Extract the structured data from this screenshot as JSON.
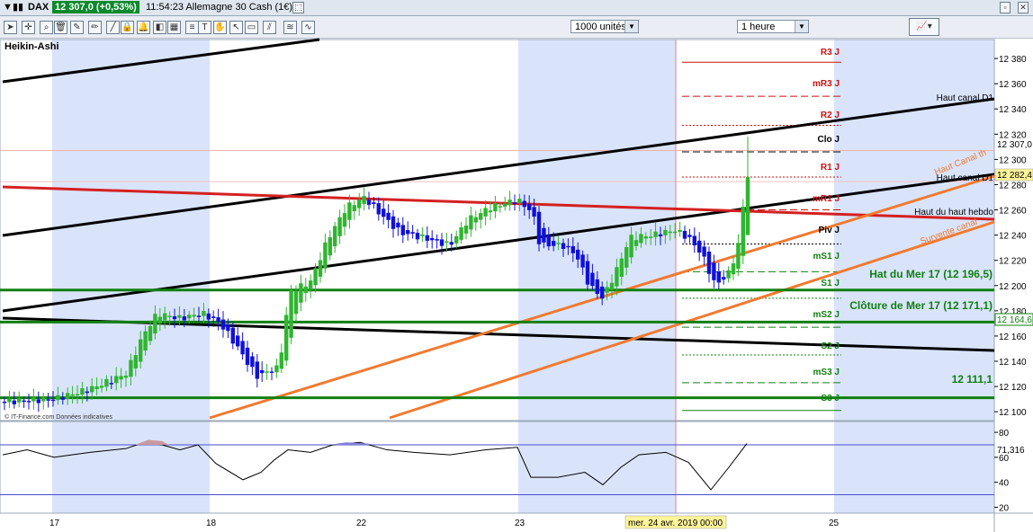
{
  "app": {
    "symbol": "DAX",
    "price": "12 307,0 (+0,53%)",
    "time_instrument": "11:54:23 Allemagne 30 Cash (1€)",
    "chart_type": "Heikin-Ashi",
    "units_select": "1000 unités",
    "timeframe_select": "1 heure",
    "watermark": "© IT-Finance.com Données indicatives"
  },
  "price_axis": {
    "ticks": [
      "12 380",
      "12 360",
      "12 340",
      "12 320",
      "12 300",
      "12 280",
      "12 260",
      "12 240",
      "12 220",
      "12 200",
      "12 180",
      "12 160",
      "12 140",
      "12 120",
      "12 100"
    ],
    "current_price_label": "12 307,0",
    "marker_282": "12 282,4",
    "marker_164": "12 164,6"
  },
  "pivot_labels": {
    "r3": "R3 J",
    "mr3": "mR3 J",
    "r2": "R2 J",
    "clo": "Clo J",
    "r1": "R1 J",
    "mr1": "mR1 J",
    "piv": "Piv J",
    "ms1": "mS1 J",
    "s1": "S1 J",
    "ms2": "mS2 J",
    "s2": "S2 J",
    "ms3": "mS3 J",
    "s3": "S3 J"
  },
  "annotations": {
    "haut_canal_d1_top": "Haut canal D1",
    "haut_canal_d1_mid": "Haut canal D1",
    "haut_canal_th": "Haut Canal th",
    "haut_du_haut_hebdo": "Haut du haut hebdo",
    "survente_canal": "Survente canal",
    "hat_mer": "Hat du Mer 17 (12 196,5)",
    "cloture_mer": "Clôture de Mer 17 (12 171,1)",
    "level_12111": "12 111,1"
  },
  "oscillator": {
    "ticks": [
      "80",
      "60",
      "40",
      "20"
    ],
    "value_label": "71,316"
  },
  "time_axis": {
    "labels": [
      "17",
      "18",
      "22",
      "23",
      "25"
    ],
    "cursor_label": "mer. 24 avr. 2019 00:00"
  },
  "chart_data": {
    "type": "candlestick",
    "y_range": [
      12093,
      12395
    ],
    "oscillator_range": [
      16,
      88
    ],
    "pivots": {
      "R3 J": 12377,
      "mR3 J": 12350,
      "R2 J": 12327,
      "Clo J": 12306,
      "R1 J": 12286,
      "mR1 J": 12260,
      "Piv J": 12233,
      "mS1 J": 12211,
      "S1 J": 12190,
      "mS2 J": 12167,
      "S2 J": 12145,
      "mS3 J": 12123,
      "S3 J": 12101
    },
    "horizontal_levels": [
      12196.5,
      12171.1,
      12111.1
    ],
    "current_price": 12307.0,
    "oscillator_level": 71.316
  },
  "colors": {
    "bull": "#2fb52f",
    "bear": "#1010d8",
    "shade": "#d9e4fb",
    "resistance": "#cc1010",
    "support": "#108010",
    "trend": "#000000",
    "orange": "#f07a30"
  }
}
